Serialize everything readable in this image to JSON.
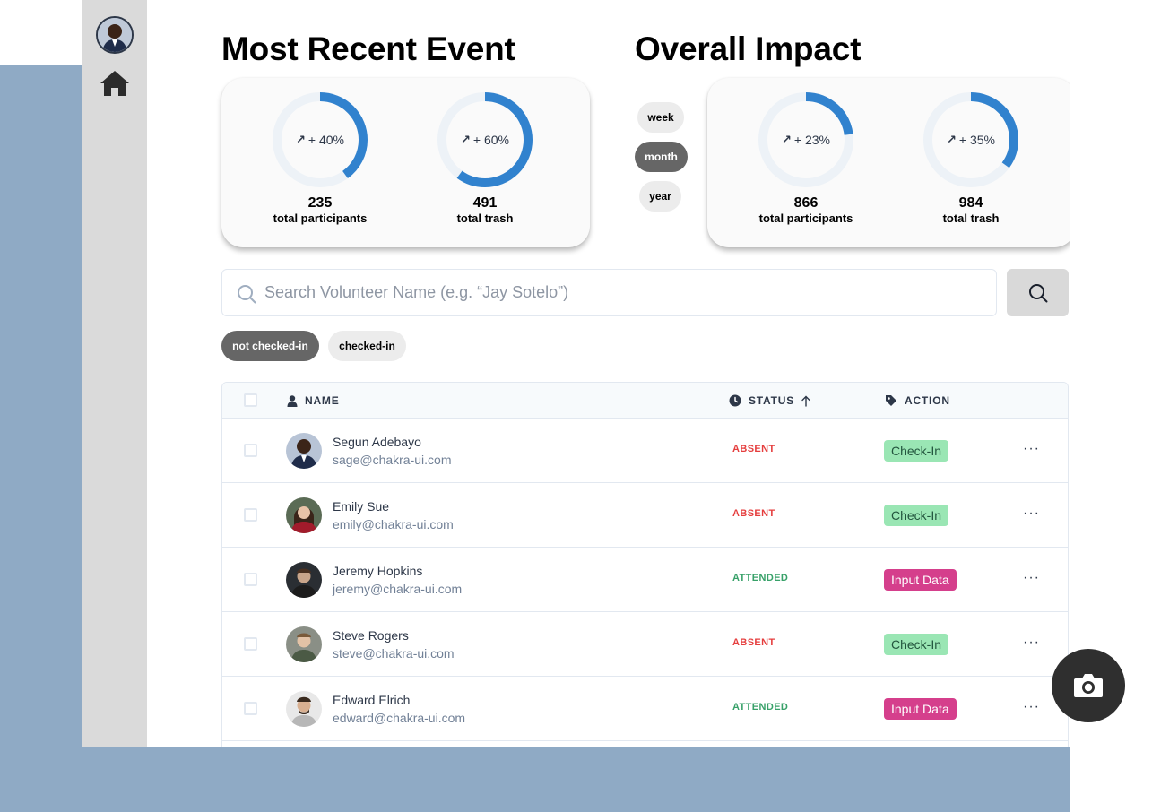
{
  "colors": {
    "accent_blue": "#3182ce",
    "ring_track": "#edf2f7",
    "absent": "#e53e3e",
    "attended": "#38a169",
    "checkin_bg": "#9ae6b4",
    "input_bg": "#d53f8c",
    "bg_blue": "#8faac5"
  },
  "sidebar": {
    "avatar": "user-avatar",
    "home_icon": "home-icon"
  },
  "recent": {
    "title": "Most Recent Event",
    "stats": [
      {
        "percent_text": "+ 40%",
        "percent": 40,
        "value": "235",
        "label": "total participants"
      },
      {
        "percent_text": "+ 60%",
        "percent": 60,
        "value": "491",
        "label": "total trash"
      }
    ]
  },
  "impact": {
    "title": "Overall Impact",
    "periods": [
      "week",
      "month",
      "year"
    ],
    "selected_period": "month",
    "stats": [
      {
        "percent_text": "+ 23%",
        "percent": 23,
        "value": "866",
        "label": "total participants"
      },
      {
        "percent_text": "+ 35%",
        "percent": 35,
        "value": "984",
        "label": "total trash"
      }
    ]
  },
  "search": {
    "placeholder": "Search Volunteer Name (e.g. “Jay Sotelo”)",
    "value": ""
  },
  "filters": {
    "not_checked_in": "not checked-in",
    "checked_in": "checked-in",
    "selected": "not checked-in"
  },
  "table": {
    "headers": {
      "name": "NAME",
      "status": "STATUS",
      "action": "ACTION"
    },
    "rows": [
      {
        "name": "Segun Adebayo",
        "email": "sage@chakra-ui.com",
        "status": "ABSENT",
        "action": "Check-In"
      },
      {
        "name": "Emily Sue",
        "email": "emily@chakra-ui.com",
        "status": "ABSENT",
        "action": "Check-In"
      },
      {
        "name": "Jeremy Hopkins",
        "email": "jeremy@chakra-ui.com",
        "status": "ATTENDED",
        "action": "Input Data"
      },
      {
        "name": "Steve Rogers",
        "email": "steve@chakra-ui.com",
        "status": "ABSENT",
        "action": "Check-In"
      },
      {
        "name": "Edward Elrich",
        "email": "edward@chakra-ui.com",
        "status": "ATTENDED",
        "action": "Input Data"
      }
    ],
    "more_label": "···"
  },
  "fab": {
    "icon": "camera-icon"
  }
}
